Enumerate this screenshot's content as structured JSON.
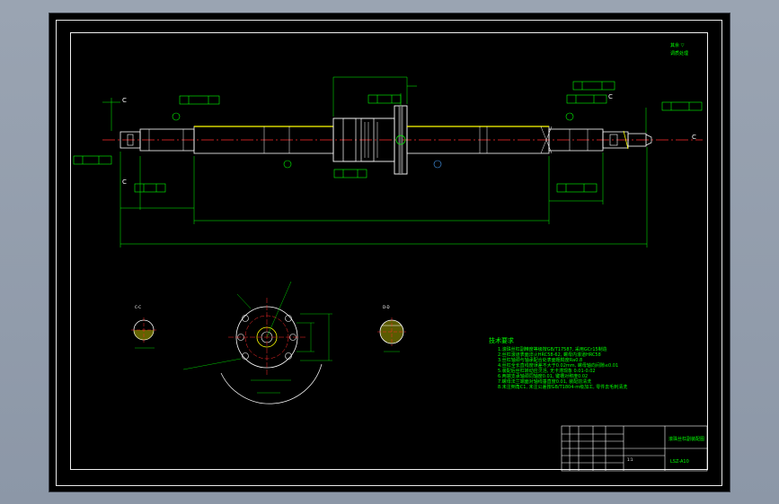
{
  "drawing": {
    "top_note_1": "其余 ▽",
    "top_note_2": "调质处理",
    "section_labels": {
      "a": "C",
      "b": "C",
      "c": "C",
      "d": "C"
    },
    "section_view_1": "C-C",
    "section_view_2": "D-D",
    "tech_title": "技术要求",
    "tech_requirements": [
      "1.滚珠丝杠副精度等级按GB/T17587, 采用GCr15制造",
      "2.丝杠滚道表面淬火HRC58-62, 螺母内滚道HRC58",
      "3.丝杠轴颈与轴承配合处表面粗糙度Ra0.8",
      "4.丝杠全长直线度误差不大于0.02mm, 螺母轴向间隙≤0.01",
      "5.装配后丝杠转动应灵活, 无卡滞现象 0.01-0.02",
      "6.两端支承轴颈同轴度0.01, 键槽对称度0.02",
      "7.螺母法兰端面对轴线垂直度0.01, 装配前清洗",
      "8.未注倒角C1, 未注公差按GB/T1804-m级加工, 零件去毛刺清洗"
    ],
    "title_block": {
      "name": "滚珠丝杠副装配图",
      "code": "LSZ-A10",
      "scale": "1:1"
    }
  }
}
